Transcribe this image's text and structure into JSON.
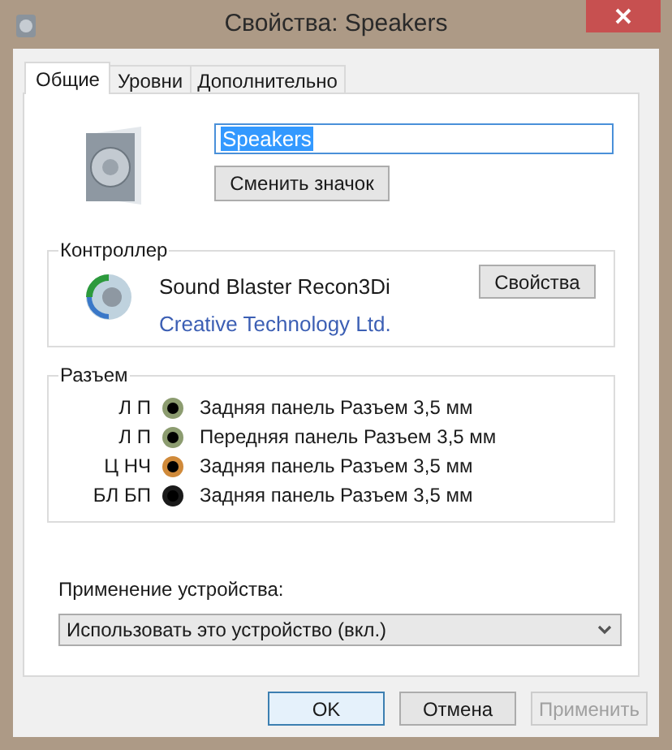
{
  "window": {
    "title": "Свойства: Speakers"
  },
  "tabs": [
    {
      "label": "Общие",
      "selected": true
    },
    {
      "label": "Уровни",
      "selected": false
    },
    {
      "label": "Дополнительно",
      "selected": false
    }
  ],
  "name_field": {
    "value": "Speakers",
    "highlighted": true
  },
  "change_icon_button": "Сменить значок",
  "controller": {
    "title": "Контроллер",
    "name": "Sound Blaster Recon3Di",
    "vendor_link": "Creative Technology Ltd.",
    "properties_button": "Свойства"
  },
  "jacks": {
    "title": "Разъем",
    "rows": [
      {
        "channels": "Л П",
        "color": "#8c9c70",
        "description": "Задняя панель Разъем 3,5 мм"
      },
      {
        "channels": "Л П",
        "color": "#8c9c70",
        "description": "Передняя панель Разъем 3,5 мм"
      },
      {
        "channels": "Ц НЧ",
        "color": "#d08a3a",
        "description": "Задняя панель Разъем 3,5 мм"
      },
      {
        "channels": "БЛ БП",
        "color": "#1a1a1a",
        "description": "Задняя панель Разъем 3,5 мм"
      }
    ]
  },
  "device_usage": {
    "label": "Применение устройства:",
    "value": "Использовать это устройство (вкл.)"
  },
  "buttons": [
    {
      "label": "OK",
      "default": true,
      "disabled": false
    },
    {
      "label": "Отмена",
      "default": false,
      "disabled": false
    },
    {
      "label": "Применить",
      "default": false,
      "disabled": true
    }
  ]
}
